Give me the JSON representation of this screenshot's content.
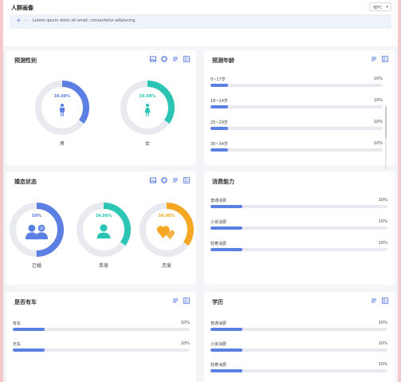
{
  "header": {
    "title": "人群画像",
    "select_label": "按PC",
    "select_chevron": "▾"
  },
  "notice": {
    "icon": "+",
    "dash": "–",
    "text": "Lorem ipsum dolor sit amet, consectetur adipiscing"
  },
  "colors": {
    "blue": "#5b7fe3",
    "teal": "#2cc5b3",
    "orange": "#f5a623",
    "track": "#e8eaef"
  },
  "gender": {
    "title": "预测性别",
    "items": [
      {
        "pct": "34.98%",
        "label": "男",
        "value": 0.3498,
        "color": "#5b7fe3",
        "icon": "male-icon"
      },
      {
        "pct": "34.98%",
        "label": "女",
        "value": 0.3498,
        "color": "#2cc5b3",
        "icon": "female-icon"
      }
    ]
  },
  "age": {
    "title": "预测年龄",
    "rows": [
      {
        "name": "0~17岁",
        "val": "10%",
        "value": 0.1
      },
      {
        "name": "18~24岁",
        "val": "10%",
        "value": 0.1
      },
      {
        "name": "25~29岁",
        "val": "10%",
        "value": 0.1
      },
      {
        "name": "30~34岁",
        "val": "10%",
        "value": 0.1
      }
    ]
  },
  "marital": {
    "title": "婚恋状态",
    "items": [
      {
        "pct": "50%",
        "label": "已婚",
        "value": 0.5,
        "color": "#5b7fe3",
        "icon": "couple-icon"
      },
      {
        "pct": "34.98%",
        "label": "单身",
        "value": 0.3498,
        "color": "#2cc5b3",
        "icon": "single-person-icon"
      },
      {
        "pct": "34.98%",
        "label": "恋爱",
        "value": 0.3498,
        "color": "#f5a623",
        "icon": "hearts-icon"
      }
    ]
  },
  "consumption": {
    "title": "消费能力",
    "rows": [
      {
        "name": "普通消费",
        "val": "10%",
        "value": 0.18
      },
      {
        "name": "小资消费",
        "val": "10%",
        "value": 0.18
      },
      {
        "name": "轻奢消费",
        "val": "10%",
        "value": 0.18
      }
    ]
  },
  "car": {
    "title": "是否有车",
    "rows": [
      {
        "name": "有车",
        "val": "10%",
        "value": 0.18
      },
      {
        "name": "无车",
        "val": "10%",
        "value": 0.18
      }
    ]
  },
  "education": {
    "title": "学历",
    "rows": [
      {
        "name": "普通消费",
        "val": "10%",
        "value": 0.18
      },
      {
        "name": "小资消费",
        "val": "10%",
        "value": 0.18
      },
      {
        "name": "轻奢消费",
        "val": "10%",
        "value": 0.18
      }
    ]
  }
}
